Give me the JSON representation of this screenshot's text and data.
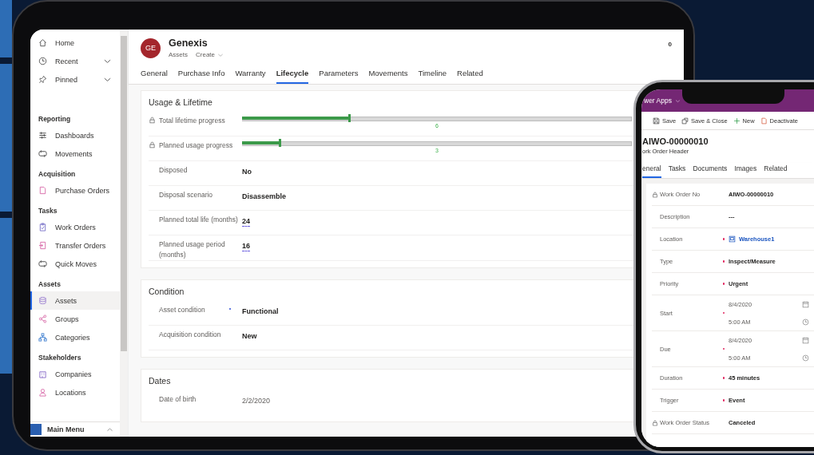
{
  "tablet": {
    "sidebar": {
      "top_items": [
        {
          "label": "Home",
          "kind": "link"
        },
        {
          "label": "Recent",
          "kind": "expander",
          "expanded": false
        },
        {
          "label": "Pinned",
          "kind": "expander",
          "expanded": false
        }
      ],
      "groups": [
        {
          "title": "Reporting",
          "items": [
            {
              "label": "Dashboards",
              "selected": false
            },
            {
              "label": "Movements",
              "selected": false
            }
          ]
        },
        {
          "title": "Acquisition",
          "items": [
            {
              "label": "Purchase Orders",
              "selected": false
            }
          ]
        },
        {
          "title": "Tasks",
          "items": [
            {
              "label": "Work Orders",
              "selected": false
            },
            {
              "label": "Transfer Orders",
              "selected": false
            },
            {
              "label": "Quick Moves",
              "selected": false
            }
          ]
        },
        {
          "title": "Assets",
          "items": [
            {
              "label": "Assets",
              "selected": true
            },
            {
              "label": "Groups",
              "selected": false
            },
            {
              "label": "Categories",
              "selected": false
            }
          ]
        },
        {
          "title": "Stakeholders",
          "items": [
            {
              "label": "Companies",
              "selected": false
            },
            {
              "label": "Locations",
              "selected": false
            }
          ]
        }
      ],
      "area_switcher": {
        "label": "Main Menu"
      }
    },
    "record": {
      "initials": "GE",
      "title": "Genexis",
      "entity": "Assets",
      "form": "Create",
      "count": "0"
    },
    "tabs": [
      {
        "label": "General",
        "selected": false
      },
      {
        "label": "Purchase Info",
        "selected": false
      },
      {
        "label": "Warranty",
        "selected": false
      },
      {
        "label": "Lifecycle",
        "selected": true
      },
      {
        "label": "Parameters",
        "selected": false
      },
      {
        "label": "Movements",
        "selected": false
      },
      {
        "label": "Timeline",
        "selected": false
      },
      {
        "label": "Related",
        "selected": false
      }
    ],
    "sections": [
      {
        "title": "Usage & Lifetime",
        "fields": [
          {
            "kind": "slider",
            "label": "Total lifetime progress",
            "locked": true,
            "required": false,
            "level": 0.28,
            "reading": "6"
          },
          {
            "kind": "slider",
            "label": "Planned usage progress",
            "locked": true,
            "required": false,
            "level": 0.1,
            "reading": "3"
          },
          {
            "kind": "text",
            "label": "Disposed",
            "locked": false,
            "required": false,
            "value": "No"
          },
          {
            "kind": "text",
            "label": "Disposal scenario",
            "locked": false,
            "required": false,
            "value": "Disassemble"
          },
          {
            "kind": "number",
            "label": "Planned total life (months)",
            "locked": false,
            "required": false,
            "value": "24"
          },
          {
            "kind": "number",
            "label": "Planned usage period (months)",
            "locked": false,
            "required": false,
            "value": "16"
          }
        ]
      },
      {
        "title": "Condition",
        "fields": [
          {
            "kind": "text",
            "label": "Asset condition",
            "locked": false,
            "required": true,
            "value": "Functional"
          },
          {
            "kind": "text",
            "label": "Acquisition condition",
            "locked": false,
            "required": false,
            "value": "New"
          }
        ]
      },
      {
        "title": "Dates",
        "fields": [
          {
            "kind": "plain",
            "label": "Date of birth",
            "locked": false,
            "required": false,
            "value": "2/2/2020"
          }
        ]
      }
    ]
  },
  "phone": {
    "app_title": "wer Apps",
    "commands": [
      {
        "label": "Save",
        "kind": "save"
      },
      {
        "label": "Save & Close",
        "kind": "save_close"
      },
      {
        "label": "New",
        "kind": "new"
      },
      {
        "label": "Deactivate",
        "kind": "deactivate"
      }
    ],
    "record": {
      "title": "AIWO-00000010",
      "subtitle": "ork Order Header"
    },
    "tabs": [
      {
        "label": "eneral",
        "selected": true
      },
      {
        "label": "Tasks",
        "selected": false
      },
      {
        "label": "Documents",
        "selected": false
      },
      {
        "label": "Images",
        "selected": false
      },
      {
        "label": "Related",
        "selected": false
      }
    ],
    "fields": [
      {
        "kind": "text",
        "label": "Work Order No",
        "locked": true,
        "required": false,
        "value": "AIWO-00000010"
      },
      {
        "kind": "text",
        "label": "Description",
        "locked": false,
        "required": false,
        "value": "---"
      },
      {
        "kind": "lookup",
        "label": "Location",
        "locked": false,
        "required": true,
        "value": "Warehouse1"
      },
      {
        "kind": "text",
        "label": "Type",
        "locked": false,
        "required": true,
        "value": "Inspect/Measure"
      },
      {
        "kind": "text",
        "label": "Priority",
        "locked": false,
        "required": true,
        "value": "Urgent"
      },
      {
        "kind": "datetime",
        "label": "Start",
        "locked": false,
        "required": true,
        "date": "8/4/2020",
        "time": "5:00 AM"
      },
      {
        "kind": "datetime",
        "label": "Due",
        "locked": false,
        "required": true,
        "date": "8/4/2020",
        "time": "5:00 AM"
      },
      {
        "kind": "text",
        "label": "Duration",
        "locked": false,
        "required": true,
        "value": "45 minutes"
      },
      {
        "kind": "text",
        "label": "Trigger",
        "locked": false,
        "required": true,
        "value": "Event"
      },
      {
        "kind": "text",
        "label": "Work Order Status",
        "locked": true,
        "required": false,
        "value": "Canceled"
      }
    ]
  }
}
